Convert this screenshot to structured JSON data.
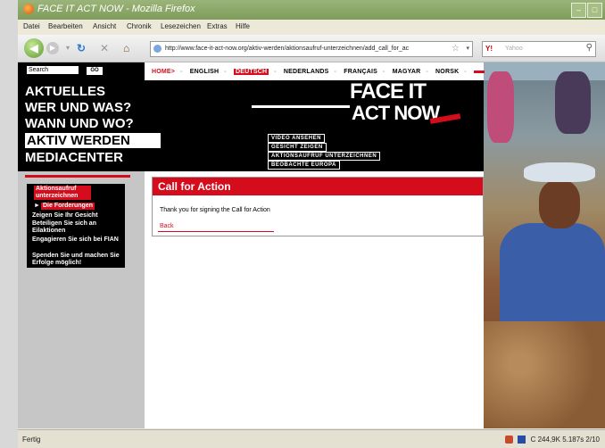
{
  "window": {
    "title": "FACE IT ACT NOW - Mozilla Firefox"
  },
  "menu": [
    "Datei",
    "Bearbeiten",
    "Ansicht",
    "Chronik",
    "Lesezeichen",
    "Extras",
    "Hilfe"
  ],
  "address": {
    "url": "http://www.face-it-act-now.org/aktiv-werden/aktionsaufruf-unterzeichnen/add_call_for_ac"
  },
  "search_bar": {
    "placeholder": "Yahoo"
  },
  "header": {
    "search_label": "Search",
    "go_label": "GO",
    "home": "HOME>",
    "languages": [
      "ENGLISH",
      "DEUTSCH",
      "NEDERLANDS",
      "FRANÇAIS",
      "MAGYAR",
      "NORSK"
    ],
    "active_language": "DEUTSCH"
  },
  "main_nav": [
    "AKTUELLES",
    "WER UND WAS?",
    "WANN UND WO?",
    "AKTIV WERDEN",
    "MEDIACENTER"
  ],
  "logo": {
    "line1": "FACE IT",
    "line2": "ACT NOW"
  },
  "sub_nav": [
    "VIDEO ANSEHEN",
    "GESICHT ZEIGEN",
    "AKTIONSAUFRUF UNTERZEICHNEN",
    "BEOBACHTE EUROPA"
  ],
  "left_menu": {
    "current": "Aktionsaufruf unterzeichnen",
    "items": [
      "Die Forderungen",
      "Zeigen Sie Ihr Gesicht",
      "Beteiligen Sie sich an Eilaktionen",
      "Engagieren Sie sich bei FIAN",
      "Spenden Sie und machen Sie Erfolge möglich!"
    ]
  },
  "call_for_action": {
    "heading": "Call for Action",
    "message": "Thank you for signing the Call for Action",
    "back_label": "Back"
  },
  "status": {
    "text": "Fertig",
    "right": "C 244,9K 5.187s 2/10"
  },
  "colors": {
    "accent": "#d40c1c",
    "nav_bg": "#000000"
  }
}
